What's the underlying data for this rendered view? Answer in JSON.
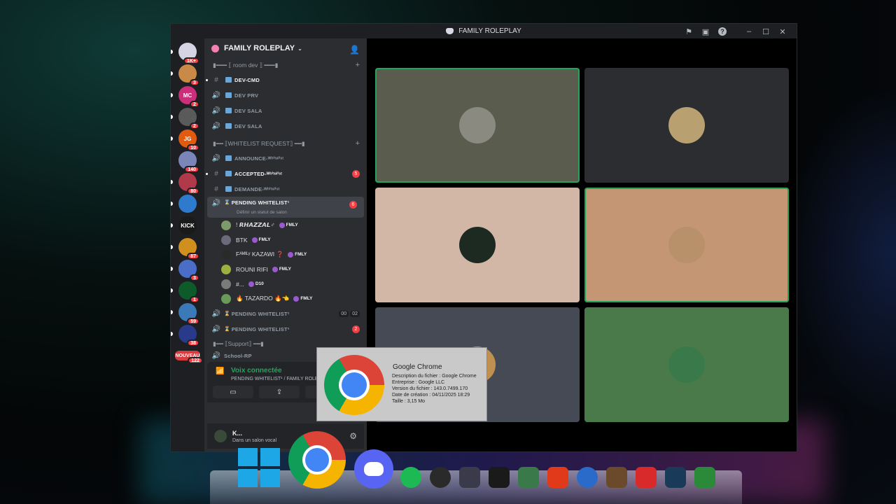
{
  "window": {
    "title": "FAMILY ROLEPLAY"
  },
  "rail": [
    {
      "label": "",
      "badge": "1K+",
      "color": "#d4d4e4"
    },
    {
      "label": "",
      "badge": "3",
      "color": "#c98a48"
    },
    {
      "label": "MC",
      "badge": "2",
      "color": "#cc2e7a"
    },
    {
      "label": "",
      "badge": "2",
      "color": "#5a5a5a"
    },
    {
      "label": "JG",
      "badge": "10",
      "color": "#e05a10"
    },
    {
      "label": "",
      "badge": "140",
      "color": "#7a86b8"
    },
    {
      "label": "",
      "badge": "80",
      "color": "#b03a4a"
    },
    {
      "label": "",
      "badge": "",
      "color": "#2e7acc"
    },
    {
      "label": "KICK",
      "badge": "",
      "color": "#1a1a1a"
    },
    {
      "label": "",
      "badge": "87",
      "color": "#d0901e"
    },
    {
      "label": "",
      "badge": "3",
      "color": "#4a6ec8"
    },
    {
      "label": "",
      "badge": "1",
      "color": "#0d5a2a"
    },
    {
      "label": "",
      "badge": "59",
      "color": "#3a7ab8"
    },
    {
      "label": "",
      "badge": "38",
      "color": "#2a3a8a"
    },
    {
      "label": "NOUVEAU",
      "badge": "122",
      "color": "#d83c3e"
    }
  ],
  "guild": {
    "name": "FAMILY ROLEPLAY"
  },
  "categories": {
    "dev": "▮━━━ ⟦ room dev ⟧ ━━━▮",
    "whitelist": "▮━━ ⟦WHITELIST REQUEST⟧ ━━▮",
    "support": "▮━━ ⟦Support⟧ ━━▮"
  },
  "channels": [
    {
      "name": "DEV-CMD",
      "type": "#",
      "bold": true,
      "count": ""
    },
    {
      "name": "DEV PRV",
      "type": "voice",
      "bold": false,
      "count": ""
    },
    {
      "name": "DEV SALA",
      "type": "voice",
      "bold": false,
      "count": ""
    },
    {
      "name": "DEV SALA",
      "type": "voice",
      "bold": false,
      "count": ""
    }
  ],
  "wl_channels": [
    {
      "name": "ANNOUNCE-ᵂʰⁱᵗᵉˡⁱˢᵗ",
      "type": "voice",
      "bold": false,
      "count": ""
    },
    {
      "name": "ACCEPTED-ᵂʰⁱᵗᵉˡⁱˢᵗ",
      "type": "#",
      "bold": true,
      "count": "5"
    },
    {
      "name": "DEMANDE-ᵂʰⁱᵗᵉˡⁱˢᵗ",
      "type": "#",
      "bold": false,
      "count": ""
    }
  ],
  "pending": {
    "name": "PENDING WHITELIST¹",
    "count": "6",
    "status": "Définir un statut de salon"
  },
  "members": [
    {
      "name": "! 𝙍𝙃𝘼𝙕𝙕𝘼𝙇♂",
      "tag": "FMLY",
      "color": "#7d9a6a"
    },
    {
      "name": "BTK",
      "tag": "FMLY",
      "color": "#6a6a7a"
    },
    {
      "name": "Fᴬᴹᴵᴸʸ KAZAWI ❓",
      "tag": "FMLY",
      "color": "#2a2a2a"
    },
    {
      "name": "ROUNI RIFI",
      "tag": "FMLY",
      "color": "#9ab040"
    },
    {
      "name": "#...",
      "tag": "D10",
      "color": "#7a7a7a"
    },
    {
      "name": "🔥 TAZARDO 🔥👈",
      "tag": "FMLY",
      "color": "#6a9a5a"
    }
  ],
  "pending2": {
    "name": "PENDING WHITELIST²",
    "tags": [
      "00",
      "02"
    ]
  },
  "pending3": {
    "name": "PENDING WHITELIST³",
    "count": "2"
  },
  "support_channel": "School-RP",
  "voice": {
    "status": "Voix connectée",
    "path": "PENDING WHITELIST¹ / FAMILY ROLEPLAY",
    "btn_camera": "▭",
    "btn_screen": "⇪",
    "btn_activity": "✣"
  },
  "user": {
    "name": "K...",
    "status": "Dans un salon vocal"
  },
  "tiles": [
    {
      "bg": "#5a5c4e",
      "avatar": "#8a8a80",
      "speaking": true
    },
    {
      "bg": "#2b2d31",
      "avatar": "#b8a070",
      "speaking": false
    },
    {
      "bg": "#d2b7a6",
      "avatar": "#1c2a22",
      "speaking": false
    },
    {
      "bg": "#c49673",
      "avatar": "#b8906a",
      "speaking": true
    },
    {
      "bg": "#464a55",
      "avatar": "#c09050",
      "speaking": false
    },
    {
      "bg": "#4a7a4a",
      "avatar": "#3a7a4a",
      "speaking": false
    }
  ],
  "tooltip": {
    "title": "Google Chrome",
    "desc": "Description du fichier : Google Chrome",
    "company": "Entreprise : Google LLC",
    "version": "Version du fichier : 143.0.7499.170",
    "date": "Date de création : 04/11/2025 18:29",
    "size": "Taille : 3,15 Mo"
  },
  "taskbar": [
    "windows-icon",
    "chrome-icon",
    "discord-icon",
    "spotify-icon",
    "obs-icon",
    "gamepad-icon",
    "arc-raiders-icon",
    "terminal-icon",
    "ea-icon",
    "remote-desktop-icon",
    "shield-icon",
    "riot-icon",
    "steam-icon",
    "greenplay-icon"
  ]
}
